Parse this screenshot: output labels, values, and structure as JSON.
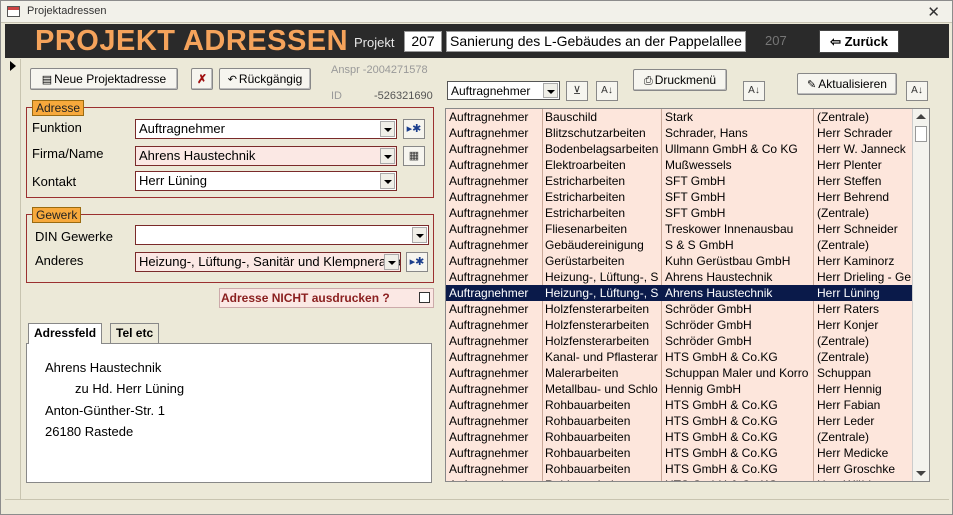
{
  "window": {
    "title": "Projektadressen"
  },
  "header": {
    "title": "PROJEKT ADRESSEN",
    "project_label": "Projekt",
    "project_number": "207",
    "project_name": "Sanierung des L-Gebäudes an der Pappelallee /",
    "project_number_dim": "207",
    "back_label": "Zurück"
  },
  "toolbar": {
    "new_address_label": "Neue Projektadresse",
    "undo_label": "Rückgängig",
    "ansprechpartner_id": "Anspr -2004271578",
    "id_label": "ID",
    "id_value": "-526321690"
  },
  "adresse": {
    "group_label": "Adresse",
    "funktion_label": "Funktion",
    "funktion_value": "Auftragnehmer",
    "firma_label": "Firma/Name",
    "firma_value": "Ahrens Haustechnik",
    "kontakt_label": "Kontakt",
    "kontakt_value": "Herr Lüning"
  },
  "gewerk": {
    "group_label": "Gewerk",
    "din_label": "DIN Gewerke",
    "din_value": "",
    "anderes_label": "Anderes",
    "anderes_value": "Heizung-, Lüftung-, Sanitär und Klempnerarbeiten"
  },
  "nicht_drucken": {
    "label": "Adresse NICHT ausdrucken ?",
    "checked": false
  },
  "tabs": [
    {
      "label": "Adressfeld",
      "active": true
    },
    {
      "label": "Tel etc",
      "active": false
    }
  ],
  "adressfeld": {
    "line1": "Ahrens Haustechnik",
    "line2": "zu Hd. Herr Lüning",
    "line3": "Anton-Günther-Str. 1",
    "line4": "26180 Rastede"
  },
  "list_controls": {
    "filter_value": "Auftragnehmer",
    "print_menu_label": "Druckmenü",
    "refresh_label": "Aktualisieren"
  },
  "list": {
    "selected_index": 11,
    "rows": [
      [
        "Auftragnehmer",
        "Bauschild",
        "Stark",
        "(Zentrale)"
      ],
      [
        "Auftragnehmer",
        "Blitzschutzarbeiten",
        "Schrader, Hans",
        "Herr Schrader"
      ],
      [
        "Auftragnehmer",
        "Bodenbelagsarbeiten",
        "Ullmann GmbH & Co KG",
        "Herr W. Janneck"
      ],
      [
        "Auftragnehmer",
        "Elektroarbeiten",
        "Mußwessels",
        "Herr Plenter"
      ],
      [
        "Auftragnehmer",
        "Estricharbeiten",
        "SFT GmbH",
        "Herr Steffen"
      ],
      [
        "Auftragnehmer",
        "Estricharbeiten",
        "SFT GmbH",
        "Herr Behrend"
      ],
      [
        "Auftragnehmer",
        "Estricharbeiten",
        "SFT GmbH",
        "(Zentrale)"
      ],
      [
        "Auftragnehmer",
        "Fliesenarbeiten",
        "Treskower Innenausbau",
        "Herr Schneider"
      ],
      [
        "Auftragnehmer",
        "Gebäudereinigung",
        "S & S GmbH",
        "(Zentrale)"
      ],
      [
        "Auftragnehmer",
        "Gerüstarbeiten",
        "Kuhn Gerüstbau GmbH",
        "Herr Kaminorz"
      ],
      [
        "Auftragnehmer",
        "Heizung-, Lüftung-, Sa",
        "Ahrens Haustechnik",
        "Herr Drieling - Ge"
      ],
      [
        "Auftragnehmer",
        "Heizung-, Lüftung-, Sa",
        "Ahrens Haustechnik",
        "Herr Lüning"
      ],
      [
        "Auftragnehmer",
        "Holzfensterarbeiten",
        "Schröder GmbH",
        "Herr Raters"
      ],
      [
        "Auftragnehmer",
        "Holzfensterarbeiten",
        "Schröder GmbH",
        "Herr Konjer"
      ],
      [
        "Auftragnehmer",
        "Holzfensterarbeiten",
        "Schröder GmbH",
        "(Zentrale)"
      ],
      [
        "Auftragnehmer",
        "Kanal- und Pflasterar",
        "HTS GmbH & Co.KG",
        "(Zentrale)"
      ],
      [
        "Auftragnehmer",
        "Malerarbeiten",
        "Schuppan Maler und Korro",
        "Schuppan"
      ],
      [
        "Auftragnehmer",
        "Metallbau- und Schlo",
        "Hennig GmbH",
        "Herr Hennig"
      ],
      [
        "Auftragnehmer",
        "Rohbauarbeiten",
        "HTS GmbH & Co.KG",
        "Herr Fabian"
      ],
      [
        "Auftragnehmer",
        "Rohbauarbeiten",
        "HTS GmbH & Co.KG",
        "Herr Leder"
      ],
      [
        "Auftragnehmer",
        "Rohbauarbeiten",
        "HTS GmbH & Co.KG",
        "(Zentrale)"
      ],
      [
        "Auftragnehmer",
        "Rohbauarbeiten",
        "HTS GmbH & Co.KG",
        "Herr Medicke"
      ],
      [
        "Auftragnehmer",
        "Rohbauarbeiten",
        "HTS GmbH & Co.KG",
        "Herr Groschke"
      ],
      [
        "Auftragnehmer",
        "Rohbauarbeiten",
        "HTS GmbH & Co.KG",
        "Herr Wübb"
      ]
    ]
  },
  "colors": {
    "header_bg": "#2a2a2a",
    "header_title": "#f5a35b",
    "group_border": "#9b3030",
    "group_label_bg": "#f7a93c",
    "list_bg": "#fde6dc",
    "selected_row": "#0a1a4a"
  },
  "icons": {
    "back": "exit-door-icon",
    "new": "new-record-icon",
    "delete": "delete-record-icon",
    "undo": "undo-icon",
    "print": "printer-icon",
    "sort": "sort-az-icon",
    "filter_clear": "clear-filter-icon",
    "refresh": "pencil-refresh-icon",
    "new_item": "new-item-icon",
    "address_book": "address-book-icon"
  }
}
